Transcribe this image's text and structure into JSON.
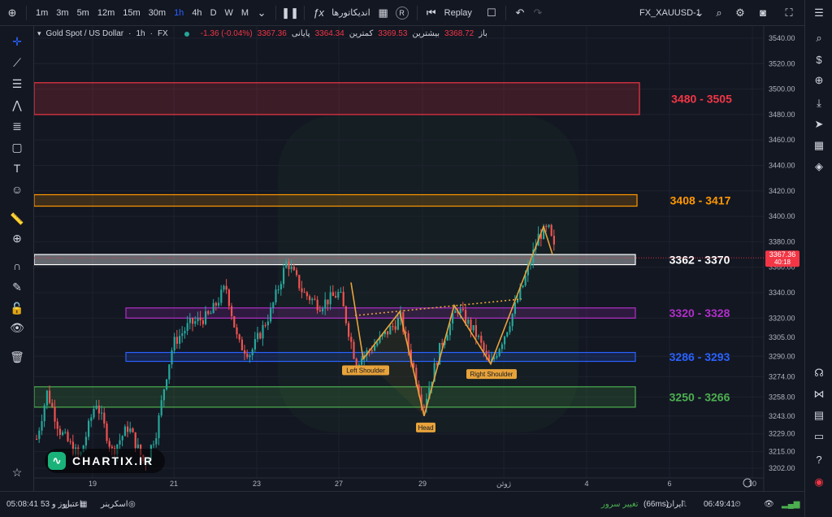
{
  "topbar": {
    "add_icon": "plus-circle-icon",
    "timeframes": [
      "1m",
      "3m",
      "5m",
      "12m",
      "15m",
      "30m",
      "1h",
      "4h",
      "D",
      "W",
      "M"
    ],
    "active_timeframe": "1h",
    "indicators_label": "اندیکاتورها",
    "replay_label": "Replay",
    "symbol_label": "FX_XAUUSD-1"
  },
  "legend": {
    "symbol": "Gold Spot / US Dollar",
    "interval": "1h",
    "exchange": "FX",
    "open_label": "باز",
    "open_value": "3368.72",
    "high_label": "بیشترین",
    "high_value": "3369.53",
    "low_label": "کمترین",
    "low_value": "3364.34",
    "close_label": "پایانی",
    "close_value": "3367.36",
    "change": "-1.36 (-0.04%)"
  },
  "price_axis": {
    "labels": [
      "3540.00",
      "3520.00",
      "3500.00",
      "3480.00",
      "3460.00",
      "3440.00",
      "3420.00",
      "3400.00",
      "3380.00",
      "3360.00",
      "3340.00",
      "3320.00",
      "3305.00",
      "3290.00",
      "3274.00",
      "3258.00",
      "3243.00",
      "3229.00",
      "3215.00",
      "3202.00"
    ],
    "current_price": "3367.36",
    "countdown": "40:18"
  },
  "time_axis": {
    "labels": [
      "19",
      "21",
      "23",
      "27",
      "29",
      "ژوئن",
      "4",
      "6",
      "10"
    ]
  },
  "zones": [
    {
      "label": "3480 - 3505",
      "low": 3480,
      "high": 3505,
      "color": "#f23645"
    },
    {
      "label": "3408 - 3417",
      "low": 3408,
      "high": 3417,
      "color": "#ff9800"
    },
    {
      "label": "3362 - 3370",
      "low": 3362,
      "high": 3370,
      "color": "#ffffff"
    },
    {
      "label": "3320 - 3328",
      "low": 3320,
      "high": 3328,
      "color": "#b02fc9"
    },
    {
      "label": "3286 - 3293",
      "low": 3286,
      "high": 3293,
      "color": "#2962ff"
    },
    {
      "label": "3250 - 3266",
      "low": 3250,
      "high": 3266,
      "color": "#4caf50"
    }
  ],
  "pattern_labels": {
    "left_shoulder": "Left Shoulder",
    "head": "Head",
    "right_shoulder": "Right Shoulder"
  },
  "logo": {
    "text": "CHARTIX.IR"
  },
  "bottombar": {
    "credit_label": "اعتبار",
    "credit_value": "53 روز و",
    "time_left": "05:08:41",
    "screener_label": "اسکرینر",
    "server_change": "تغییر سرور",
    "server_name": "ایران",
    "latency": "(66ms)",
    "clock": "06:49:41"
  },
  "colors": {
    "bg": "#131722",
    "up": "#26a69a",
    "down": "#ef5350",
    "pattern": "#e8a33a"
  }
}
